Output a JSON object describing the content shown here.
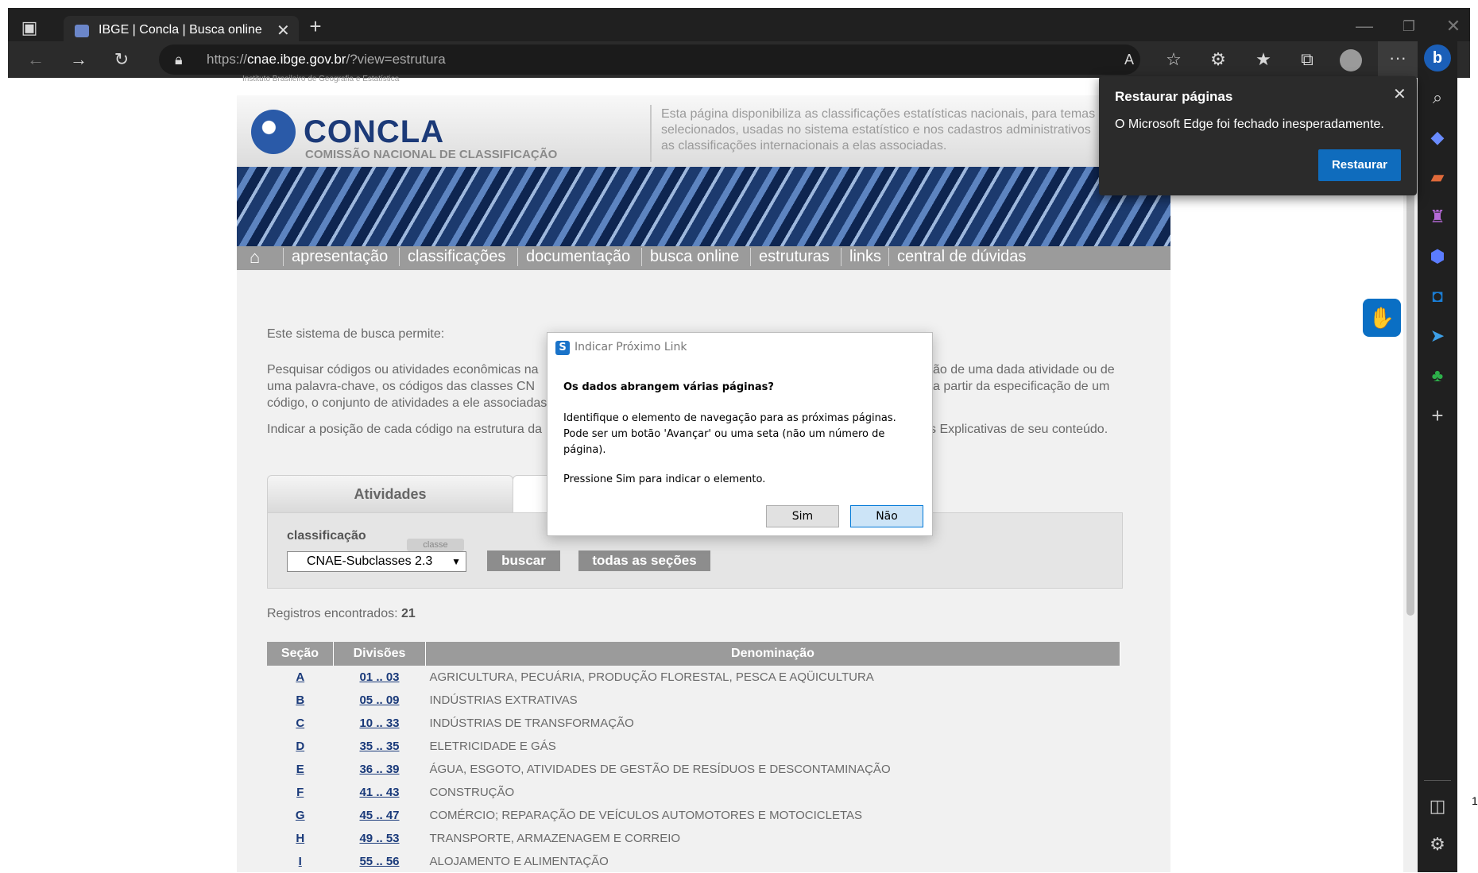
{
  "browser": {
    "tab_title": "IBGE | Concla | Busca online",
    "url_prefix": "https://",
    "url_host": "cnae.ibge.gov.br",
    "url_path": "/?view=estrutura"
  },
  "site": {
    "header_small": "Instituto Brasileiro de Geografia e Estatística",
    "logo_title": "CONCLA",
    "logo_subtitle": "COMISSÃO NACIONAL DE CLASSIFICAÇÃO",
    "header_desc_1": "Esta página disponibiliza as classificações estatísticas nacionais, para temas",
    "header_desc_2": "selecionados, usadas no sistema estatístico e nos cadastros administrativos",
    "header_desc_3": "as classificações internacionais a elas associadas.",
    "nav": [
      "apresentação",
      "classificações",
      "documentação",
      "busca online",
      "estruturas",
      "links",
      "central de dúvidas"
    ],
    "intro": "Este sistema de busca permite:",
    "para1_l1a": "Pesquisar códigos ou atividades econômicas na",
    "para1_l1b": "ão de uma dada atividade ou de",
    "para1_l2a": "uma palavra-chave, os códigos das classes CN",
    "para1_l2b": "a partir da especificação de um",
    "para1_l3": "código, o conjunto de atividades a ele associadas",
    "para2_a": "Indicar a posição de cada código na estrutura da",
    "para2_b": "s Explicativas de seu conteúdo.",
    "tab_atividades": "Atividades",
    "classificacao_label": "classificação",
    "classe_badge": "classe",
    "select_value": "CNAE-Subclasses 2.3",
    "btn_buscar": "buscar",
    "btn_todas": "todas as seções",
    "registros_label": "Registros encontrados:",
    "registros_count": "21",
    "table_headers": [
      "Seção",
      "Divisões",
      "Denominação"
    ],
    "rows": [
      {
        "secao": "A",
        "div": "01 .. 03",
        "den": "AGRICULTURA, PECUÁRIA, PRODUÇÃO FLORESTAL, PESCA E AQÜICULTURA"
      },
      {
        "secao": "B",
        "div": "05 .. 09",
        "den": "INDÚSTRIAS EXTRATIVAS"
      },
      {
        "secao": "C",
        "div": "10 .. 33",
        "den": "INDÚSTRIAS DE TRANSFORMAÇÃO"
      },
      {
        "secao": "D",
        "div": "35 .. 35",
        "den": "ELETRICIDADE E GÁS"
      },
      {
        "secao": "E",
        "div": "36 .. 39",
        "den": "ÁGUA, ESGOTO, ATIVIDADES DE GESTÃO DE RESÍDUOS E DESCONTAMINAÇÃO"
      },
      {
        "secao": "F",
        "div": "41 .. 43",
        "den": "CONSTRUÇÃO"
      },
      {
        "secao": "G",
        "div": "45 .. 47",
        "den": "COMÉRCIO; REPARAÇÃO DE VEÍCULOS AUTOMOTORES E MOTOCICLETAS"
      },
      {
        "secao": "H",
        "div": "49 .. 53",
        "den": "TRANSPORTE, ARMAZENAGEM E CORREIO"
      },
      {
        "secao": "I",
        "div": "55 .. 56",
        "den": "ALOJAMENTO E ALIMENTAÇÃO"
      }
    ]
  },
  "restore_popup": {
    "title": "Restaurar páginas",
    "message": "O Microsoft Edge foi fechado inesperadamente.",
    "button": "Restaurar"
  },
  "dialog": {
    "title": "Indicar Próximo Link",
    "question": "Os dados abrangem várias páginas?",
    "body_l1": "Identifique o elemento de navegação para as próximas páginas.",
    "body_l2": "Pode ser um botão 'Avançar' ou uma seta (não um número de",
    "body_l3": "página).",
    "body_l4": "Pressione Sim para indicar o elemento.",
    "btn_yes": "Sim",
    "btn_no": "Não"
  },
  "edge_number": "1"
}
